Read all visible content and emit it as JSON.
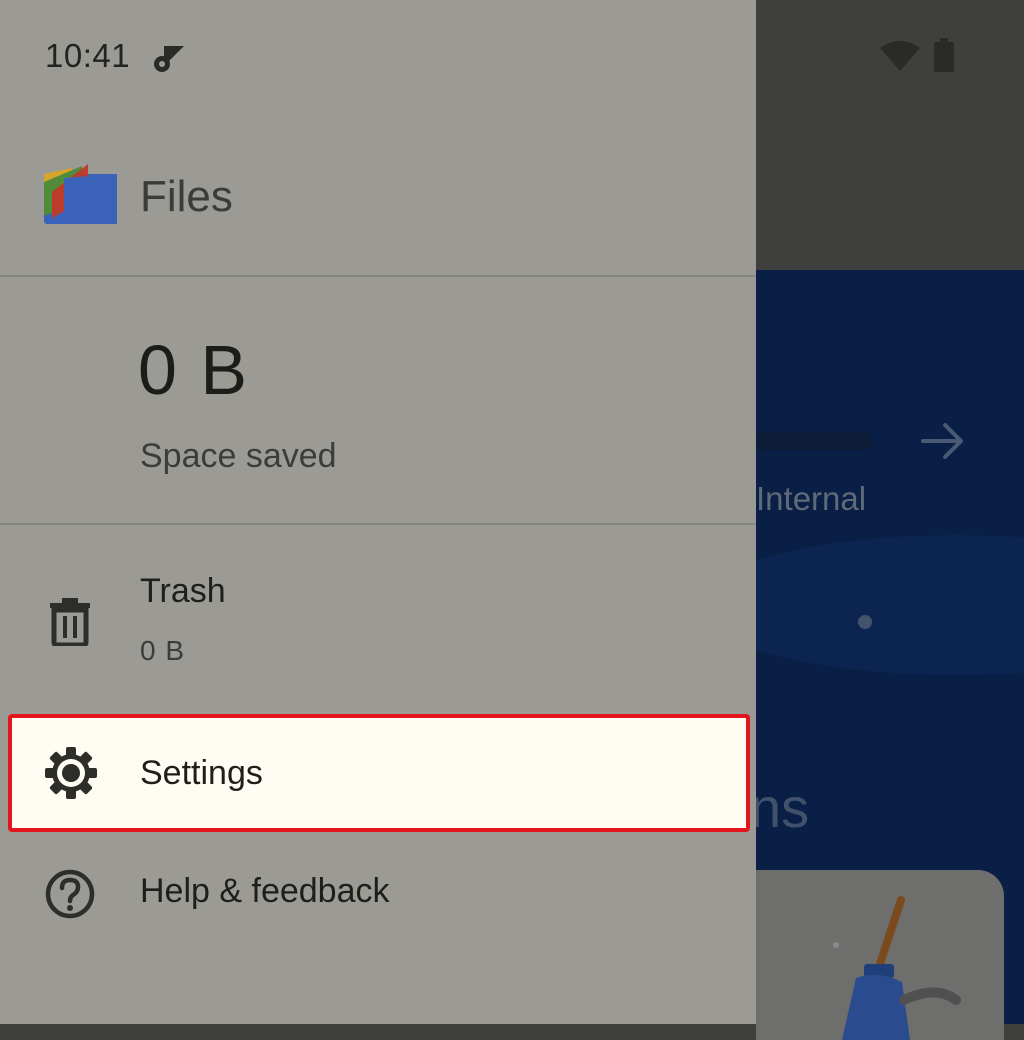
{
  "status_bar": {
    "time": "10:41",
    "icons": [
      "settings-sync-icon",
      "wifi-icon",
      "battery-icon"
    ]
  },
  "drawer": {
    "app_title": "Files",
    "space_saved_value": "0 B",
    "space_saved_label": "Space saved",
    "items": [
      {
        "label": "Trash",
        "sublabel": "0 B",
        "icon": "trash-icon"
      },
      {
        "label": "Settings",
        "icon": "gear-icon"
      },
      {
        "label": "Help & feedback",
        "icon": "help-icon"
      }
    ]
  },
  "background": {
    "storage_label": "Internal",
    "section_partial": "ns"
  },
  "colors": {
    "drawer_bg": "#9b9a95",
    "highlight": "#fffcf4",
    "highlight_border": "#e3141b",
    "hero_bg": "#0a1f45"
  }
}
